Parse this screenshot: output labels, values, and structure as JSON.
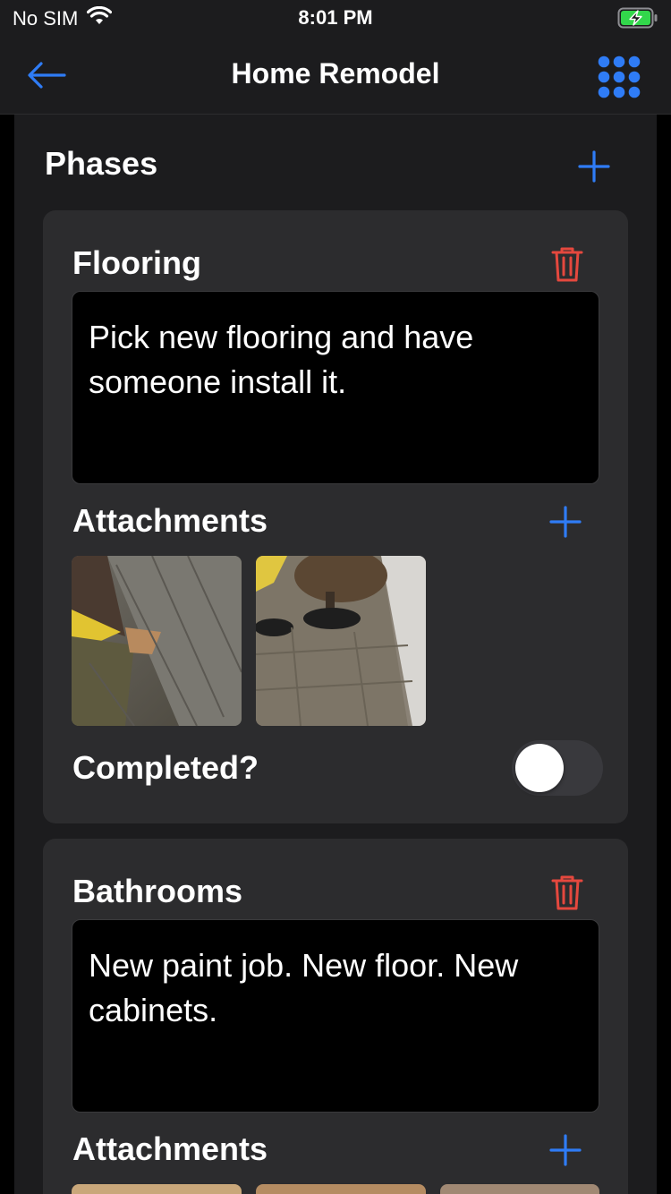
{
  "status_bar": {
    "carrier": "No SIM",
    "time": "8:01 PM",
    "icons": [
      "wifi-icon",
      "battery-charging-icon"
    ]
  },
  "nav": {
    "title": "Home Remodel",
    "back_icon": "arrow-left-icon",
    "menu_icon": "grid-icon"
  },
  "phases": {
    "header": "Phases",
    "add_icon": "plus-icon",
    "items": [
      {
        "title": "Flooring",
        "description": "Pick new flooring and have someone install it.",
        "attachments_label": "Attachments",
        "attachments": [
          "photo-floor-1",
          "photo-floor-2"
        ],
        "completed_label": "Completed?",
        "completed": false
      },
      {
        "title": "Bathrooms",
        "description": "New paint job. New floor. New cabinets.",
        "attachments_label": "Attachments",
        "attachments": [
          "photo-bath-1",
          "photo-bath-2",
          "photo-bath-3"
        ]
      }
    ]
  },
  "colors": {
    "accent": "#2f7cf6",
    "destructive": "#e5483e",
    "card": "#2c2c2e",
    "background": "#1c1c1e"
  }
}
